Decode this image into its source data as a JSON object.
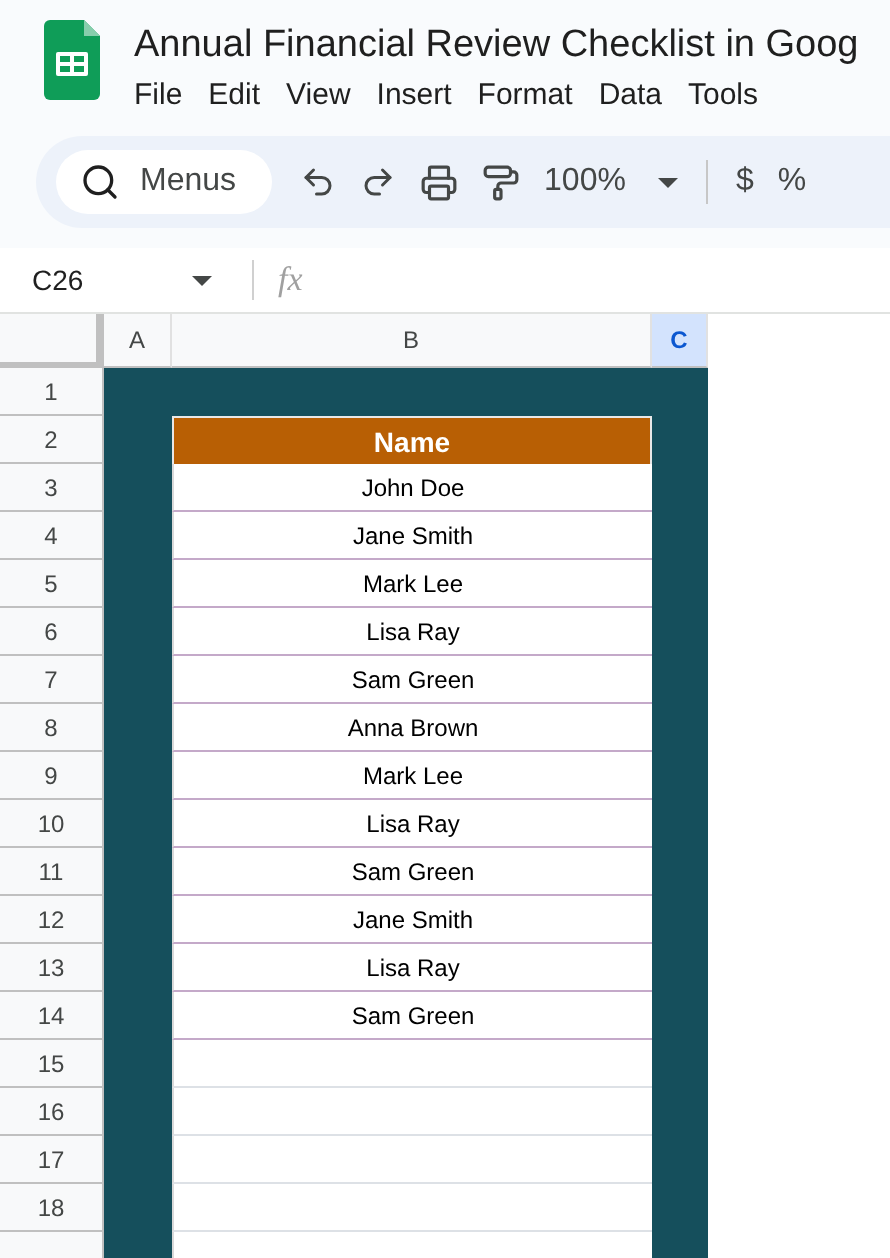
{
  "document": {
    "title": "Annual Financial Review Checklist in Goog"
  },
  "menu": [
    "File",
    "Edit",
    "View",
    "Insert",
    "Format",
    "Data",
    "Tools"
  ],
  "toolbar": {
    "search_label": "Menus",
    "zoom": "100%",
    "currency": "$",
    "percent": "%"
  },
  "formula_bar": {
    "name_box": "C26",
    "fx": "fx"
  },
  "columns": [
    {
      "label": "A",
      "selected": false
    },
    {
      "label": "B",
      "selected": false
    },
    {
      "label": "C",
      "selected": true
    }
  ],
  "row_numbers": [
    "1",
    "2",
    "3",
    "4",
    "5",
    "6",
    "7",
    "8",
    "9",
    "10",
    "11",
    "12",
    "13",
    "14",
    "15",
    "16",
    "17",
    "18"
  ],
  "table": {
    "header": "Name",
    "rows": [
      "John Doe",
      "Jane Smith",
      "Mark Lee",
      "Lisa Ray",
      "Sam Green",
      "Anna Brown",
      "Mark Lee",
      "Lisa Ray",
      "Sam Green",
      "Jane Smith",
      "Lisa Ray",
      "Sam Green"
    ]
  }
}
